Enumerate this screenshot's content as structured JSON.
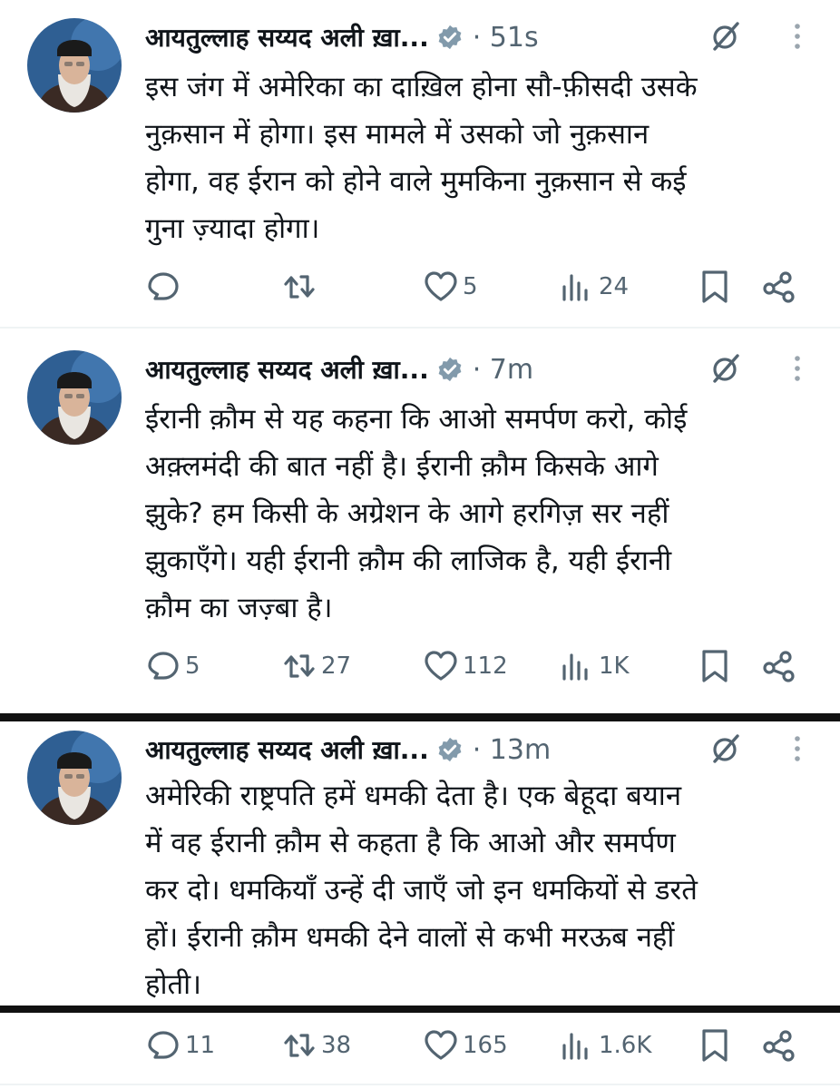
{
  "tweets": [
    {
      "author": "आयतुल्लाह सय्यद अली ख़ा...",
      "time": "· 51s",
      "text": "इस जंग में अमेरिका का दाख़िल होना सौ-फ़ीसदी उसके\nनुक़सान में होगा। इस मामले में उसको जो नुक़सान\nहोगा, वह ईरान को होने वाले मुमकिना नुक़सान से कई\nगुना ज़्यादा होगा।",
      "replies": "",
      "reposts": "",
      "likes": "5",
      "views": "24"
    },
    {
      "author": "आयतुल्लाह सय्यद अली ख़ा...",
      "time": "· 7m",
      "text": "ईरानी क़ौम से यह कहना कि आओ समर्पण करो, कोई\nअक़्लमंदी की बात नहीं है। ईरानी क़ौम किसके आगे\nझुके? हम किसी के अग्रेशन के आगे हरगिज़ सर नहीं\nझुकाएँगे। यही ईरानी क़ौम की लाजिक है, यही ईरानी\nक़ौम का जज़्बा है।",
      "replies": "5",
      "reposts": "27",
      "likes": "112",
      "views": "1K"
    },
    {
      "author": "आयतुल्लाह सय्यद अली ख़ा...",
      "time": "· 13m",
      "text": "अमेरिकी राष्ट्रपति हमें धमकी देता है। एक बेहूदा बयान\nमें वह ईरानी क़ौम से कहता है कि आओ और समर्पण\nकर दो। धमकियाँ उन्हें दी जाएँ जो इन धमकियों से डरते\nहों। ईरानी क़ौम धमकी देने वालों से कभी मरऊब नहीं\nहोती।",
      "replies": "11",
      "reposts": "38",
      "likes": "165",
      "views": "1.6K"
    }
  ],
  "icons": {
    "verified": "verified-badge-icon",
    "grok": "grok-icon",
    "more": "more-options-icon",
    "reply": "reply-icon",
    "repost": "repost-icon",
    "like": "like-icon",
    "views": "views-icon",
    "bookmark": "bookmark-icon",
    "share": "share-icon"
  },
  "colors": {
    "text": "#0f1419",
    "muted": "#536471",
    "verified": "#829aab"
  }
}
